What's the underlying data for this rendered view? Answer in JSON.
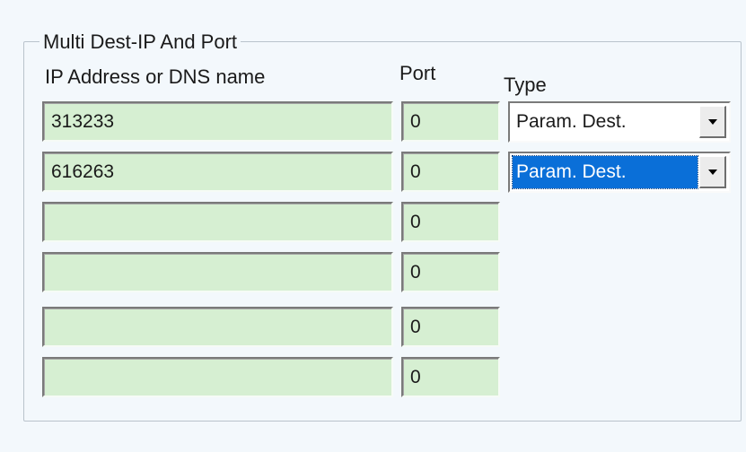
{
  "group_title": "Multi Dest-IP And Port",
  "headers": {
    "ip": "IP Address or DNS name",
    "port": "Port",
    "type": "Type"
  },
  "rows": [
    {
      "ip": "313233",
      "port": "0",
      "type": "Param. Dest.",
      "type_selected": false
    },
    {
      "ip": "616263",
      "port": "0",
      "type": "Param. Dest.",
      "type_selected": true
    },
    {
      "ip": "",
      "port": "0"
    },
    {
      "ip": "",
      "port": "0"
    },
    {
      "ip": "",
      "port": "0"
    },
    {
      "ip": "",
      "port": "0"
    }
  ],
  "colors": {
    "field_bg": "#d6efd2",
    "selection": "#0a6fd8",
    "panel_bg": "#f3f8fc"
  }
}
